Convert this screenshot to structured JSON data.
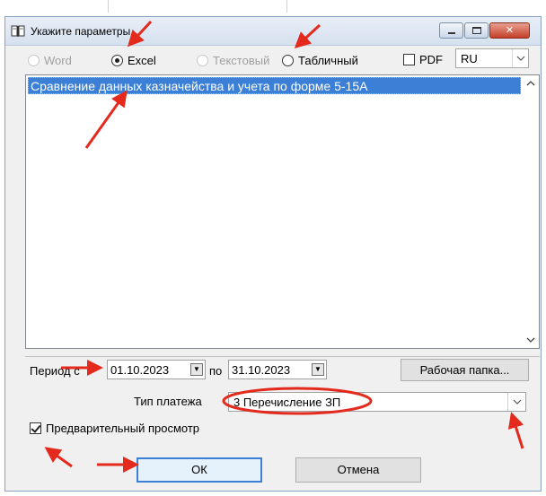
{
  "window": {
    "title": "Укажите параметры"
  },
  "format": {
    "options": [
      {
        "label": "Word",
        "state": "disabled"
      },
      {
        "label": "Excel",
        "state": "checked"
      },
      {
        "label": "Текстовый",
        "state": "disabled"
      },
      {
        "label": "Табличный",
        "state": "enabled"
      }
    ],
    "pdf_label": "PDF",
    "pdf_checked": false,
    "language_value": "RU"
  },
  "report_list": {
    "items": [
      "Сравнение данных казначейства и учета по форме 5-15А"
    ],
    "selected_index": 0
  },
  "period": {
    "label": "Период с",
    "from": "01.10.2023",
    "to_label": "по",
    "to": "31.10.2023"
  },
  "work_folder_button": "Рабочая папка...",
  "payment_type": {
    "label": "Тип платежа",
    "value": "3 Перечисление ЗП"
  },
  "preview": {
    "label": "Предварительный просмотр",
    "checked": true
  },
  "buttons": {
    "ok": "ОК",
    "cancel": "Отмена"
  },
  "colors": {
    "selection": "#3c7fd6",
    "annotation_red": "#e32a1c"
  }
}
